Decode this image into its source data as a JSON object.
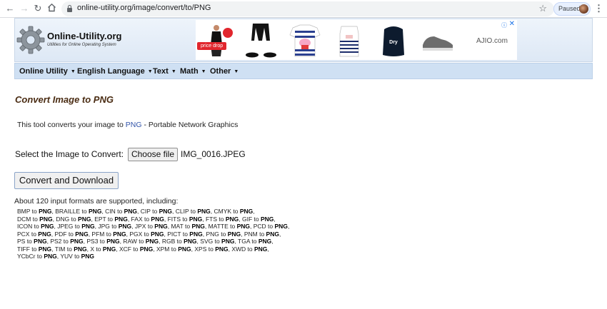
{
  "browser": {
    "url": "online-utility.org/image/convert/to/PNG",
    "profile_status": "Paused"
  },
  "site": {
    "name": "Online-Utility.org",
    "tagline": "Utilities for Online Operating System"
  },
  "ad": {
    "price_drop_label": "price drop",
    "advertiser": "AJIO.com",
    "info_icon": "info-icon",
    "close_icon": "close-icon"
  },
  "menu": {
    "items": [
      {
        "label": "Online Utility"
      },
      {
        "label": "English Language"
      },
      {
        "label": "Text"
      },
      {
        "label": "Math"
      },
      {
        "label": "Other"
      }
    ]
  },
  "main": {
    "title": "Convert Image to PNG",
    "intro_prefix": "This tool converts your image to",
    "intro_link": "PNG",
    "intro_suffix": "- Portable Network Graphics",
    "select_label": "Select the Image to Convert:",
    "choose_file_label": "Choose file",
    "file_name": "IMG_0016.JPEG",
    "convert_button": "Convert and Download",
    "formats_intro": "About 120 input formats are supported, including:",
    "format_lines": [
      [
        [
          "BMP",
          "PNG"
        ],
        [
          "BRAILLE",
          "PNG"
        ],
        [
          "CIN",
          "PNG"
        ],
        [
          "CIP",
          "PNG"
        ],
        [
          "CLIP",
          "PNG"
        ],
        [
          "CMYK",
          "PNG"
        ]
      ],
      [
        [
          "DCM",
          "PNG"
        ],
        [
          "DNG",
          "PNG"
        ],
        [
          "EPT",
          "PNG"
        ],
        [
          "FAX",
          "PNG"
        ],
        [
          "FITS",
          "PNG"
        ],
        [
          "FTS",
          "PNG"
        ],
        [
          "GIF",
          "PNG"
        ]
      ],
      [
        [
          "ICON",
          "PNG"
        ],
        [
          "JPEG",
          "PNG"
        ],
        [
          "JPG",
          "PNG"
        ],
        [
          "JPX",
          "PNG"
        ],
        [
          "MAT",
          "PNG"
        ],
        [
          "MATTE",
          "PNG"
        ],
        [
          "PCD",
          "PNG"
        ]
      ],
      [
        [
          "PCX",
          "PNG"
        ],
        [
          "PDF",
          "PNG"
        ],
        [
          "PFM",
          "PNG"
        ],
        [
          "PGX",
          "PNG"
        ],
        [
          "PICT",
          "PNG"
        ],
        [
          "PNG",
          "PNG"
        ],
        [
          "PNM",
          "PNG"
        ]
      ],
      [
        [
          "PS",
          "PNG"
        ],
        [
          "PS2",
          "PNG"
        ],
        [
          "PS3",
          "PNG"
        ],
        [
          "RAW",
          "PNG"
        ],
        [
          "RGB",
          "PNG"
        ],
        [
          "SVG",
          "PNG"
        ],
        [
          "TGA",
          "PNG"
        ]
      ],
      [
        [
          "TIFF",
          "PNG"
        ],
        [
          "TIM",
          "PNG"
        ],
        [
          "X",
          "PNG"
        ],
        [
          "XCF",
          "PNG"
        ],
        [
          "XPM",
          "PNG"
        ],
        [
          "XPS",
          "PNG"
        ],
        [
          "XWD",
          "PNG"
        ]
      ],
      [
        [
          "YCbCr",
          "PNG"
        ],
        [
          "YUV",
          "PNG"
        ]
      ]
    ],
    "pair_joiner": "to"
  },
  "colors": {
    "title": "#4a2c13",
    "link": "#3355aa",
    "menubar": "#cfe0f3",
    "price_drop": "#e1262d"
  }
}
